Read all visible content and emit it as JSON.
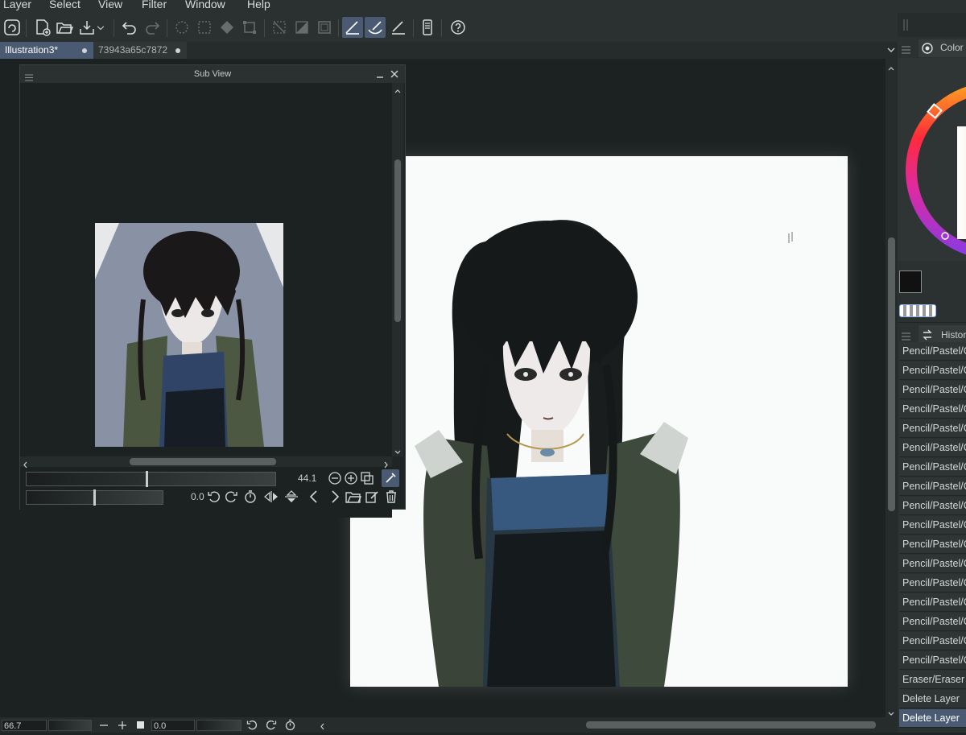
{
  "menu": {
    "items": [
      "Layer",
      "Select",
      "View",
      "Filter",
      "Window",
      "Help"
    ]
  },
  "tabs": [
    {
      "label": "Illustration3*",
      "active": true
    },
    {
      "label": "73943a65c7872",
      "active": false
    }
  ],
  "subview": {
    "title": "Sub View",
    "zoom_value": "44.1",
    "rotation_value": "0.0"
  },
  "panels": {
    "color_tab_label": "Color",
    "history_tab_label": "Histor"
  },
  "history": {
    "items": [
      "Pencil/Pastel/C",
      "Pencil/Pastel/C",
      "Pencil/Pastel/C",
      "Pencil/Pastel/C",
      "Pencil/Pastel/C",
      "Pencil/Pastel/C",
      "Pencil/Pastel/C",
      "Pencil/Pastel/C",
      "Pencil/Pastel/C",
      "Pencil/Pastel/C",
      "Pencil/Pastel/C",
      "Pencil/Pastel/C",
      "Pencil/Pastel/C",
      "Pencil/Pastel/C",
      "Pencil/Pastel/C",
      "Pencil/Pastel/C",
      "Pencil/Pastel/C",
      "Eraser/Eraser",
      "Delete Layer",
      "Delete Layer"
    ],
    "selected_index": 19
  },
  "statusbar": {
    "zoom_value": "66.7",
    "rotation_value": "0.0"
  },
  "colors": {
    "accent": "#4a5a72",
    "panel": "#2b3030",
    "canvas_bg": "#1c2121",
    "paper": "#f9fafa"
  }
}
